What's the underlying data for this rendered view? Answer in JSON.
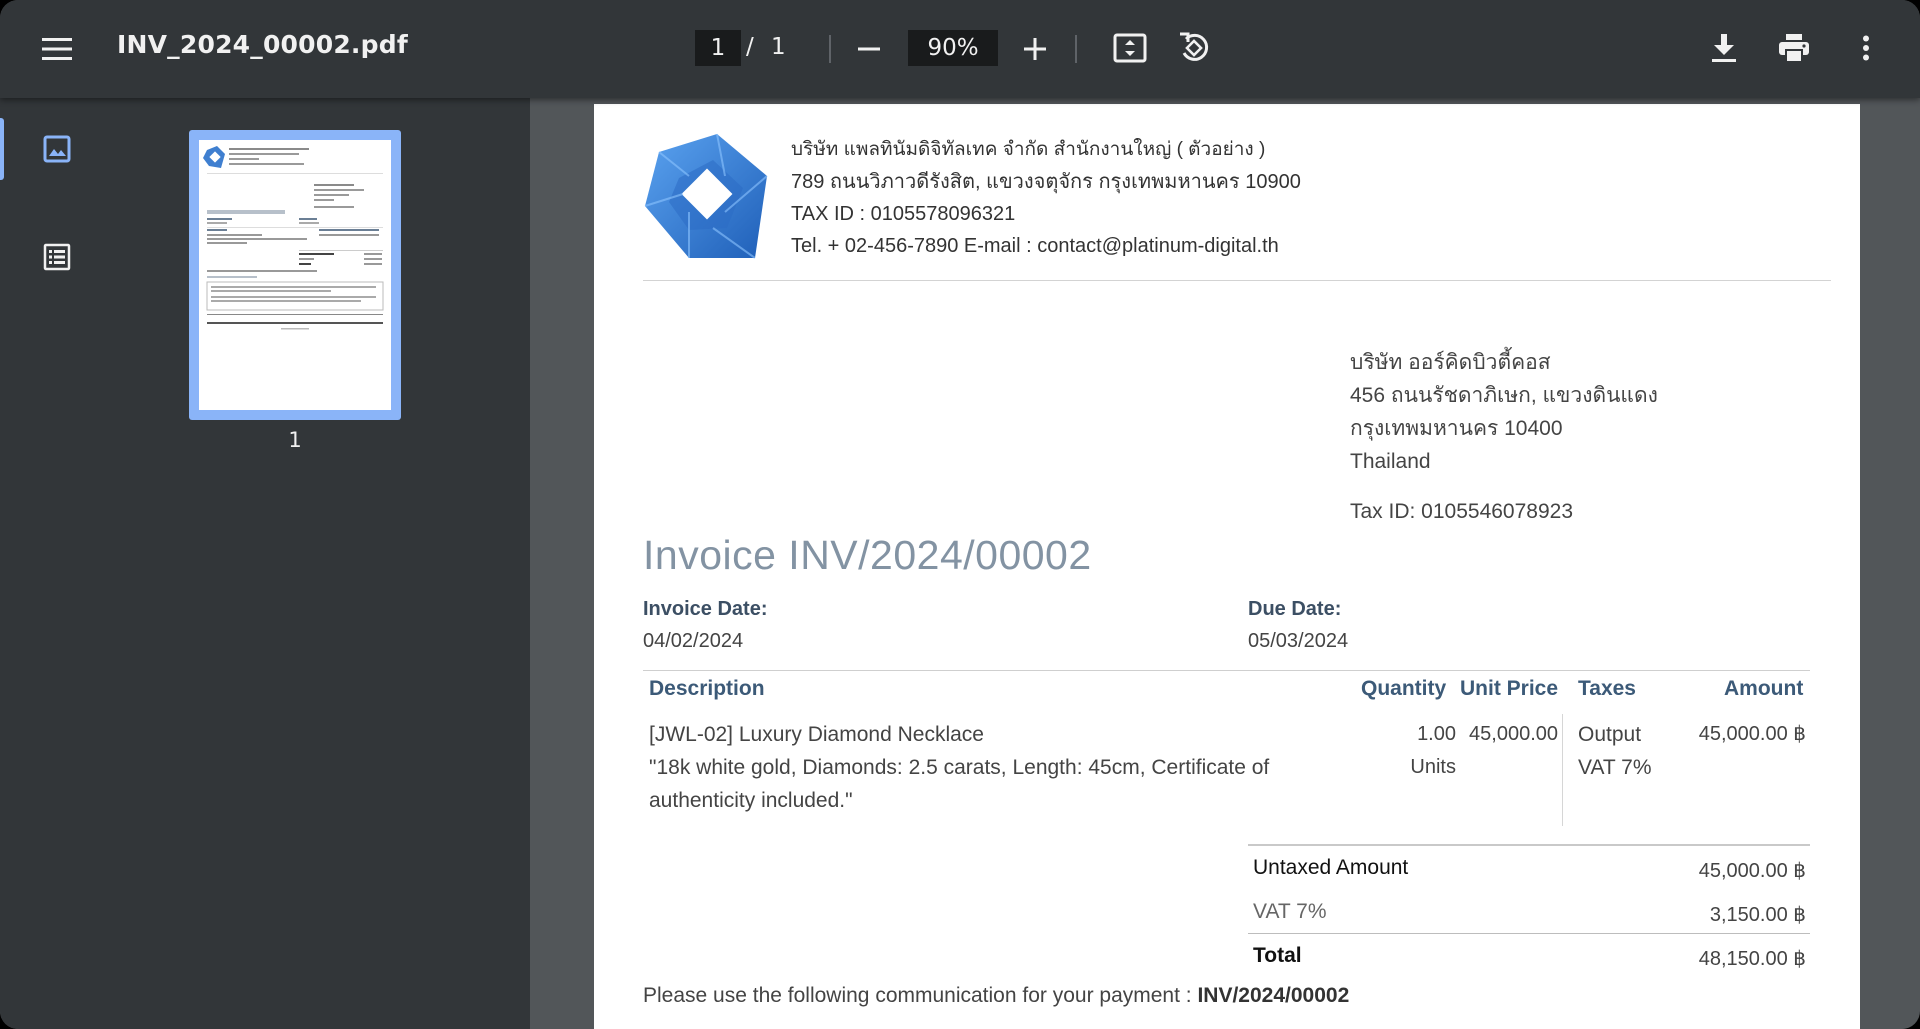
{
  "toolbar": {
    "menu_icon": "menu-icon",
    "file_name": "INV_2024_00002.pdf",
    "current_page": "1",
    "page_separator": "/",
    "total_pages": "1",
    "zoom": "90%",
    "zoom_out_icon": "minus-icon",
    "zoom_in_icon": "plus-icon",
    "fit_icon": "fit-to-page-icon",
    "rotate_icon": "rotate-icon",
    "download_icon": "download-icon",
    "print_icon": "print-icon",
    "more_icon": "more-vert-icon"
  },
  "sidebar": {
    "tabs": [
      "thumbnails-icon",
      "outline-icon"
    ],
    "selected_tab": "thumbnails",
    "thumbnail_label": "1",
    "accent_color": "#8ab4f8"
  },
  "document": {
    "company": {
      "name": "บริษัท แพลทินัมดิจิทัลเทค จำกัด สำนักงานใหญ่ ( ตัวอย่าง )",
      "address": "789 ถนนวิภาวดีรังสิต, แขวงจตุจักร กรุงเทพมหานคร 10900",
      "tax_id": "TAX ID : 0105578096321",
      "contact": "Tel. + 02-456-7890  E-mail : contact@platinum-digital.th"
    },
    "customer": {
      "name": "บริษัท ออร์คิดบิวตี้คอส",
      "address_line1": "456 ถนนรัชดาภิเษก, แขวงดินแดง",
      "address_line2": "กรุงเทพมหานคร 10400",
      "country": "Thailand",
      "tax_id": "Tax ID: 0105546078923"
    },
    "title": "Invoice INV/2024/00002",
    "invoice_date_label": "Invoice Date:",
    "invoice_date": "04/02/2024",
    "due_date_label": "Due Date:",
    "due_date": "05/03/2024",
    "table": {
      "headers": {
        "description": "Description",
        "quantity": "Quantity",
        "unit_price": "Unit Price",
        "taxes": "Taxes",
        "amount": "Amount"
      },
      "rows": [
        {
          "description_line1": "[JWL-02] Luxury Diamond Necklace",
          "description_line2": "\"18k white gold, Diamonds: 2.5 carats, Length: 45cm, Certificate of",
          "description_line3": "authenticity included.\"",
          "quantity": "1.00",
          "unit": "Units",
          "unit_price": "45,000.00",
          "taxes_line1": "Output",
          "taxes_line2": "VAT 7%",
          "amount": "45,000.00 ฿"
        }
      ]
    },
    "totals": {
      "untaxed_label": "Untaxed Amount",
      "untaxed_value": "45,000.00 ฿",
      "vat_label": "VAT 7%",
      "vat_value": "3,150.00 ฿",
      "total_label": "Total",
      "total_value": "48,150.00 ฿"
    },
    "payment_text": "Please use the following communication for your payment : ",
    "payment_reference": "INV/2024/00002"
  }
}
